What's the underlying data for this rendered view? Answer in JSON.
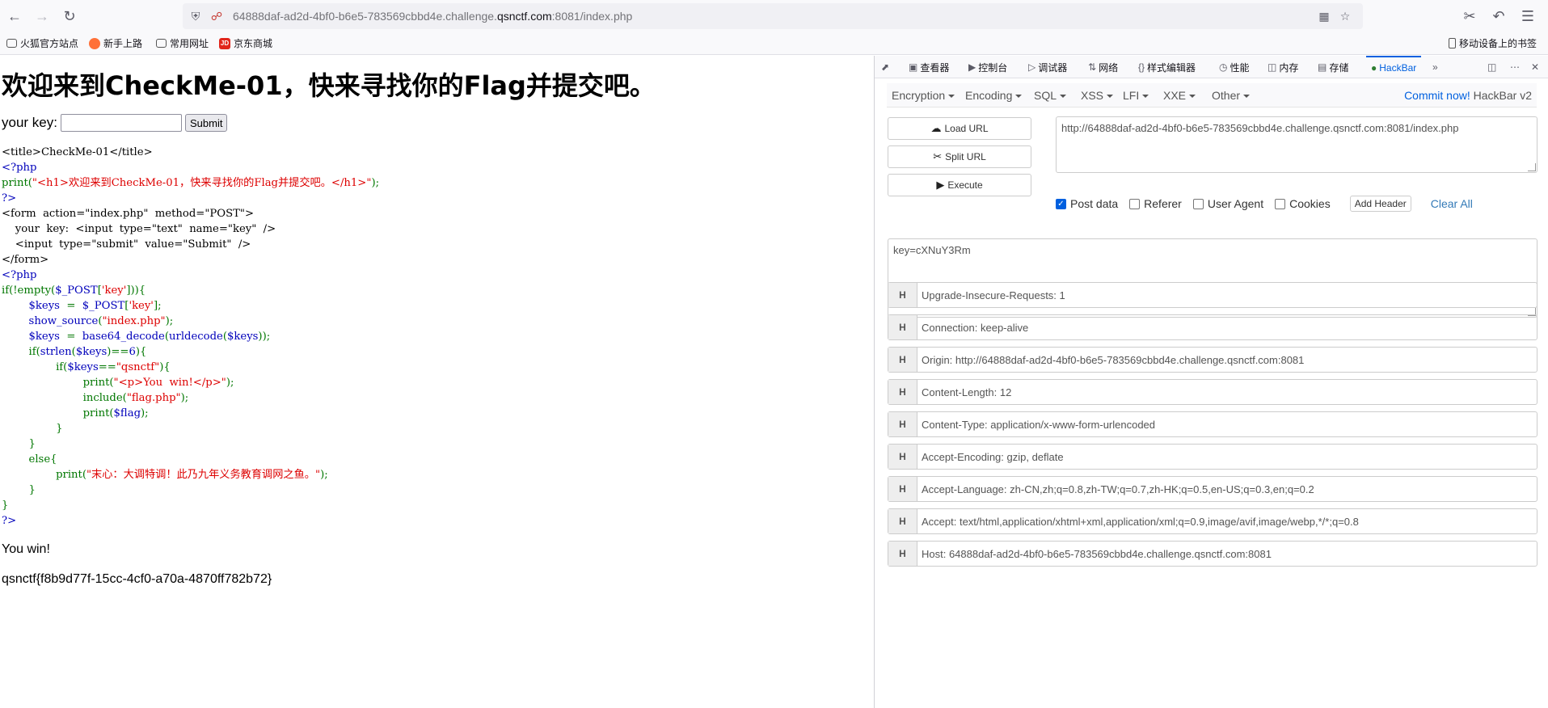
{
  "browser": {
    "url_prefix": "64888daf-ad2d-4bf0-b6e5-783569cbbd4e.challenge.",
    "url_domain": "qsnctf.com",
    "url_suffix": ":8081/index.php",
    "bookmarks": [
      "火狐官方站点",
      "新手上路",
      "常用网址",
      "京东商城"
    ],
    "mobile_bookmarks": "移动设备上的书签"
  },
  "page": {
    "heading": "欢迎来到CheckMe-01，快来寻找你的Flag并提交吧。",
    "key_label": "your key:",
    "key_value": "",
    "submit_label": "Submit",
    "source_lines": [
      [
        {
          "t": "<title>CheckMe-01</title>",
          "c": "black"
        }
      ],
      [
        {
          "t": "<?php",
          "c": "blue"
        }
      ],
      [
        {
          "t": "print(",
          "c": "green"
        },
        {
          "t": "\"<h1>欢迎来到CheckMe-01，快来寻找你的Flag并提交吧。</h1>\"",
          "c": "red"
        },
        {
          "t": ");",
          "c": "green"
        }
      ],
      [
        {
          "t": "?>",
          "c": "blue"
        }
      ],
      [
        {
          "t": "<form  action=\"index.php\"  method=\"POST\">",
          "c": "black"
        }
      ],
      [
        {
          "t": "    your  key:  <input  type=\"text\"  name=\"key\"  />",
          "c": "black"
        }
      ],
      [
        {
          "t": "    <input  type=\"submit\"  value=\"Submit\"  />",
          "c": "black"
        }
      ],
      [
        {
          "t": "</form>",
          "c": "black"
        }
      ],
      [
        {
          "t": "<?php",
          "c": "blue"
        }
      ],
      [
        {
          "t": "if(!empty(",
          "c": "green"
        },
        {
          "t": "$_POST",
          "c": "blue"
        },
        {
          "t": "[",
          "c": "green"
        },
        {
          "t": "'key'",
          "c": "red"
        },
        {
          "t": "])){",
          "c": "green"
        }
      ],
      [
        {
          "t": "        ",
          "c": "green"
        },
        {
          "t": "$keys  ",
          "c": "blue"
        },
        {
          "t": "=  ",
          "c": "green"
        },
        {
          "t": "$_POST",
          "c": "blue"
        },
        {
          "t": "[",
          "c": "green"
        },
        {
          "t": "'key'",
          "c": "red"
        },
        {
          "t": "];",
          "c": "green"
        }
      ],
      [
        {
          "t": "        ",
          "c": "green"
        },
        {
          "t": "show_source",
          "c": "blue"
        },
        {
          "t": "(",
          "c": "green"
        },
        {
          "t": "\"index.php\"",
          "c": "red"
        },
        {
          "t": ");",
          "c": "green"
        }
      ],
      [
        {
          "t": "        ",
          "c": "green"
        },
        {
          "t": "$keys  ",
          "c": "blue"
        },
        {
          "t": "=  ",
          "c": "green"
        },
        {
          "t": "base64_decode",
          "c": "blue"
        },
        {
          "t": "(",
          "c": "green"
        },
        {
          "t": "urldecode",
          "c": "blue"
        },
        {
          "t": "(",
          "c": "green"
        },
        {
          "t": "$keys",
          "c": "blue"
        },
        {
          "t": "));",
          "c": "green"
        }
      ],
      [
        {
          "t": "        if(",
          "c": "green"
        },
        {
          "t": "strlen",
          "c": "blue"
        },
        {
          "t": "(",
          "c": "green"
        },
        {
          "t": "$keys",
          "c": "blue"
        },
        {
          "t": ")==",
          "c": "green"
        },
        {
          "t": "6",
          "c": "blue"
        },
        {
          "t": "){",
          "c": "green"
        }
      ],
      [
        {
          "t": "                if(",
          "c": "green"
        },
        {
          "t": "$keys",
          "c": "blue"
        },
        {
          "t": "==",
          "c": "green"
        },
        {
          "t": "\"qsnctf\"",
          "c": "red"
        },
        {
          "t": "){",
          "c": "green"
        }
      ],
      [
        {
          "t": "                        print(",
          "c": "green"
        },
        {
          "t": "\"<p>You  win!</p>\"",
          "c": "red"
        },
        {
          "t": ");",
          "c": "green"
        }
      ],
      [
        {
          "t": "                        include(",
          "c": "green"
        },
        {
          "t": "\"flag.php\"",
          "c": "red"
        },
        {
          "t": ");",
          "c": "green"
        }
      ],
      [
        {
          "t": "                        print(",
          "c": "green"
        },
        {
          "t": "$flag",
          "c": "blue"
        },
        {
          "t": ");",
          "c": "green"
        }
      ],
      [
        {
          "t": "                }",
          "c": "green"
        }
      ],
      [
        {
          "t": "        }",
          "c": "green"
        }
      ],
      [
        {
          "t": "        else{",
          "c": "green"
        }
      ],
      [
        {
          "t": "                print(",
          "c": "green"
        },
        {
          "t": "\"末心：大调特调！此乃九年义务教育调网之鱼。\"",
          "c": "red"
        },
        {
          "t": ");",
          "c": "green"
        }
      ],
      [
        {
          "t": "        }",
          "c": "green"
        }
      ],
      [
        {
          "t": "}",
          "c": "green"
        }
      ],
      [
        {
          "t": "?>",
          "c": "blue"
        }
      ]
    ],
    "result": "You win!",
    "flag": "qsnctf{f8b9d77f-15cc-4cf0-a70a-4870ff782b72}"
  },
  "devtools": {
    "tabs": [
      "查看器",
      "控制台",
      "调试器",
      "网络",
      "样式编辑器",
      "性能",
      "内存",
      "存储",
      "HackBar"
    ],
    "hackbar": {
      "menus": [
        "Encryption",
        "Encoding",
        "SQL",
        "XSS",
        "LFI",
        "XXE",
        "Other"
      ],
      "commit_link": "Commit now!",
      "version": "HackBar v2",
      "load_url": "Load URL",
      "split_url": "Split URL",
      "execute": "Execute",
      "url_value": "http://64888daf-ad2d-4bf0-b6e5-783569cbbd4e.challenge.qsnctf.com:8081/index.php",
      "options": [
        {
          "label": "Post data",
          "checked": true
        },
        {
          "label": "Referer",
          "checked": false
        },
        {
          "label": "User Agent",
          "checked": false
        },
        {
          "label": "Cookies",
          "checked": false
        }
      ],
      "add_header": "Add Header",
      "clear_all": "Clear All",
      "post_data": "key=cXNuY3Rm",
      "header_tag": "H",
      "headers": [
        "Upgrade-Insecure-Requests: 1",
        "Connection: keep-alive",
        "Origin: http://64888daf-ad2d-4bf0-b6e5-783569cbbd4e.challenge.qsnctf.com:8081",
        "Content-Length: 12",
        "Content-Type: application/x-www-form-urlencoded",
        "Accept-Encoding: gzip, deflate",
        "Accept-Language: zh-CN,zh;q=0.8,zh-TW;q=0.7,zh-HK;q=0.5,en-US;q=0.3,en;q=0.2",
        "Accept: text/html,application/xhtml+xml,application/xml;q=0.9,image/avif,image/webp,*/*;q=0.8",
        "Host: 64888daf-ad2d-4bf0-b6e5-783569cbbd4e.challenge.qsnctf.com:8081"
      ]
    }
  }
}
